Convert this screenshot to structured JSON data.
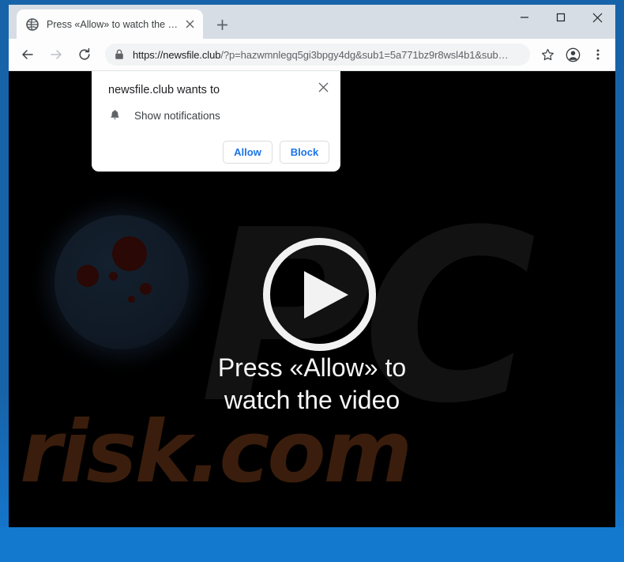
{
  "window": {
    "controls": {
      "minimize_label": "–",
      "maximize_label": "☐",
      "close_label": "×"
    }
  },
  "tabstrip": {
    "tab": {
      "title": "Press «Allow» to watch the video",
      "favicon_name": "globe-icon",
      "close_label": "×"
    },
    "new_tab_label": "+"
  },
  "toolbar": {
    "back_icon": "back-arrow-icon",
    "forward_icon": "forward-arrow-icon",
    "reload_icon": "reload-icon",
    "lock_icon": "lock-icon",
    "url_host": "https://newsfile.club",
    "url_path": "/?p=hazwmnlegq5gi3bpgy4dg&sub1=5a771bz9r8wsl4b1&sub…",
    "url_full": "https://newsfile.club/?p=hazwmnlegq5gi3bpgy4dg&sub1=5a771bz9r8wsl4b1&sub…",
    "star_icon": "star-icon",
    "profile_icon": "profile-avatar-icon",
    "menu_icon": "three-dot-menu-icon"
  },
  "permission_dialog": {
    "title": "newsfile.club wants to",
    "permission_icon": "bell-icon",
    "permission_label": "Show notifications",
    "allow_label": "Allow",
    "block_label": "Block",
    "close_label": "×"
  },
  "page": {
    "play_button_name": "play-button",
    "hero_line1": "Press «Allow» to",
    "hero_line2": "watch the video",
    "watermark_top": "PC",
    "watermark_bottom": "risk.com"
  },
  "colors": {
    "window_frame_blue": "#1763a9",
    "window_frame_blue_bottom": "#1279cf",
    "tabstrip_grey": "#d6dde5",
    "link_blue": "#1a73e8",
    "page_background": "#000000",
    "watermark_brown": "#3a1d0c",
    "watermark_grey": "#121212",
    "planet_navy": "#101a26",
    "crater_red": "#290805"
  }
}
